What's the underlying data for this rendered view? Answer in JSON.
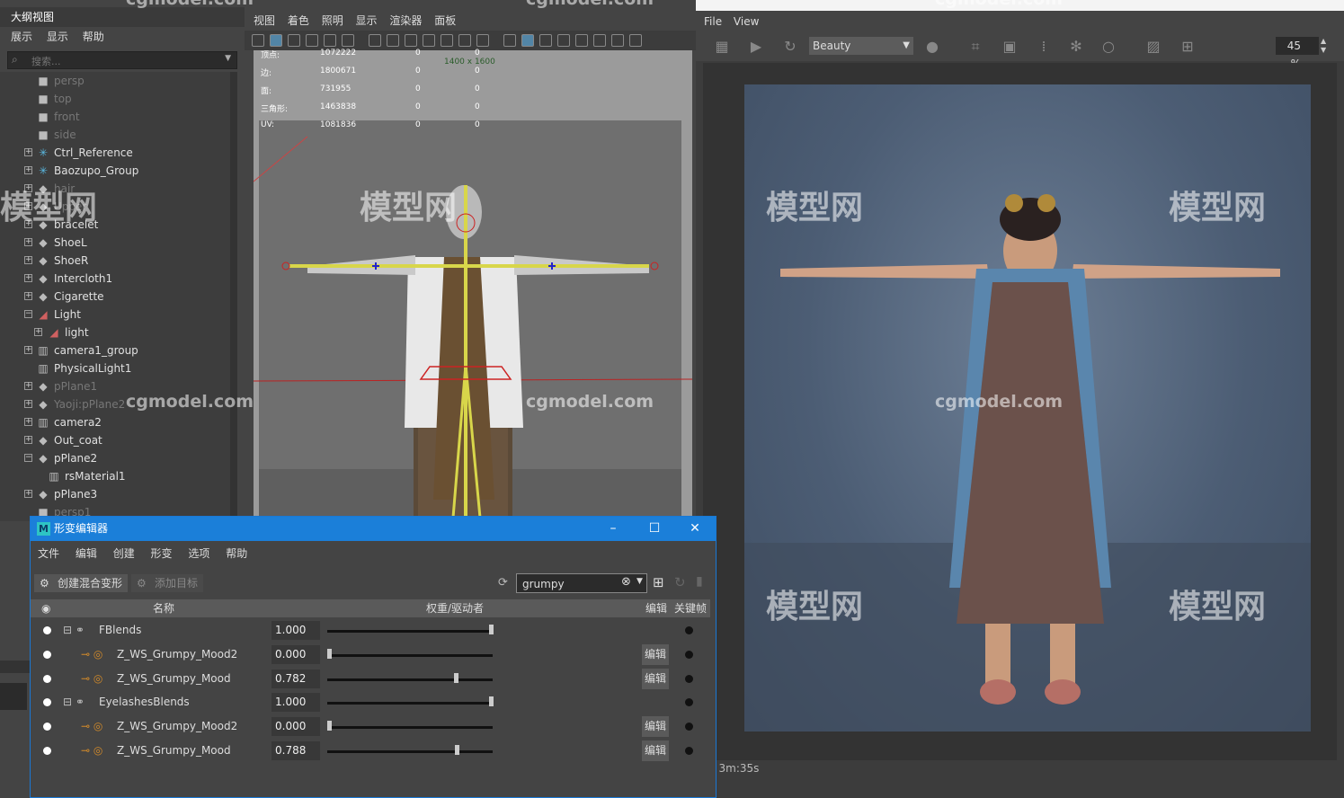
{
  "outliner": {
    "title": "大纲视图",
    "menu": [
      "展示",
      "显示",
      "帮助"
    ],
    "search_placeholder": "搜索...",
    "items": [
      {
        "label": "persp",
        "icon": "camera-icon",
        "dim": true
      },
      {
        "label": "top",
        "icon": "camera-icon",
        "dim": true
      },
      {
        "label": "front",
        "icon": "camera-icon",
        "dim": true
      },
      {
        "label": "side",
        "icon": "camera-icon",
        "dim": true
      },
      {
        "label": "Ctrl_Reference",
        "icon": "joint-icon",
        "dim": false
      },
      {
        "label": "Baozupo_Group",
        "icon": "joint-icon",
        "dim": false
      },
      {
        "label": "hair",
        "icon": "mesh-icon",
        "dim": true
      },
      {
        "label": "Upper",
        "icon": "mesh-icon",
        "dim": true
      },
      {
        "label": "bracelet",
        "icon": "mesh-icon",
        "dim": false
      },
      {
        "label": "ShoeL",
        "icon": "mesh-icon",
        "dim": false
      },
      {
        "label": "ShoeR",
        "icon": "mesh-icon",
        "dim": false
      },
      {
        "label": "Intercloth1",
        "icon": "mesh-icon",
        "dim": false
      },
      {
        "label": "Cigarette",
        "icon": "mesh-icon",
        "dim": false
      },
      {
        "label": "Light",
        "icon": "light-icon",
        "dim": false
      },
      {
        "label": "light",
        "icon": "light-icon",
        "dim": false
      },
      {
        "label": "camera1_group",
        "icon": "group-icon",
        "dim": false
      },
      {
        "label": "PhysicalLight1",
        "icon": "group-icon",
        "dim": false
      },
      {
        "label": "pPlane1",
        "icon": "mesh-icon",
        "dim": true
      },
      {
        "label": "Yaoji:pPlane2",
        "icon": "mesh-icon",
        "dim": true
      },
      {
        "label": "camera2",
        "icon": "group-icon",
        "dim": false
      },
      {
        "label": "Out_coat",
        "icon": "mesh-icon",
        "dim": false
      },
      {
        "label": "pPlane2",
        "icon": "mesh-icon",
        "dim": false
      },
      {
        "label": "rsMaterial1",
        "icon": "group-icon",
        "dim": false
      },
      {
        "label": "pPlane3",
        "icon": "mesh-icon",
        "dim": false
      },
      {
        "label": "persp1",
        "icon": "camera-icon",
        "dim": true
      }
    ]
  },
  "viewport": {
    "menu": [
      "视图",
      "着色",
      "照明",
      "显示",
      "渲染器",
      "面板"
    ],
    "hud": {
      "resolution": "1400 x 1600",
      "rows": [
        {
          "label": "顶点:",
          "value": "1072222",
          "a": "0",
          "b": "0"
        },
        {
          "label": "边:",
          "value": "1800671",
          "a": "0",
          "b": "0"
        },
        {
          "label": "面:",
          "value": "731955",
          "a": "0",
          "b": "0"
        },
        {
          "label": "三角形:",
          "value": "1463838",
          "a": "0",
          "b": "0"
        },
        {
          "label": "UV:",
          "value": "1081836",
          "a": "0",
          "b": "0"
        }
      ]
    }
  },
  "render_view": {
    "menu": [
      "File",
      "View"
    ],
    "aov": "Beauty",
    "zoom": "45 %",
    "status": "0: 3m:35s"
  },
  "shape_editor": {
    "title": "形变编辑器",
    "menu": [
      "文件",
      "编辑",
      "创建",
      "形变",
      "选项",
      "帮助"
    ],
    "create_blend_label": "创建混合变形",
    "add_target_label": "添加目标",
    "filter_value": "grumpy",
    "columns": {
      "name": "名称",
      "weight": "权重/驱动者",
      "edit": "编辑",
      "key": "关键帧"
    },
    "edit_label": "编辑",
    "rows": [
      {
        "name": "FBlends",
        "value": "1.000",
        "weight": 1.0,
        "group": true,
        "has_edit": false
      },
      {
        "name": "Z_WS_Grumpy_Mood2",
        "value": "0.000",
        "weight": 0.0,
        "group": false,
        "has_edit": true
      },
      {
        "name": "Z_WS_Grumpy_Mood",
        "value": "0.782",
        "weight": 0.782,
        "group": false,
        "has_edit": true
      },
      {
        "name": "EyelashesBlends",
        "value": "1.000",
        "weight": 1.0,
        "group": true,
        "has_edit": false
      },
      {
        "name": "Z_WS_Grumpy_Mood2",
        "value": "0.000",
        "weight": 0.0,
        "group": false,
        "has_edit": true
      },
      {
        "name": "Z_WS_Grumpy_Mood",
        "value": "0.788",
        "weight": 0.788,
        "group": false,
        "has_edit": true
      }
    ]
  },
  "watermarks": {
    "site": "cgmodel.com",
    "brand": "模型网"
  }
}
